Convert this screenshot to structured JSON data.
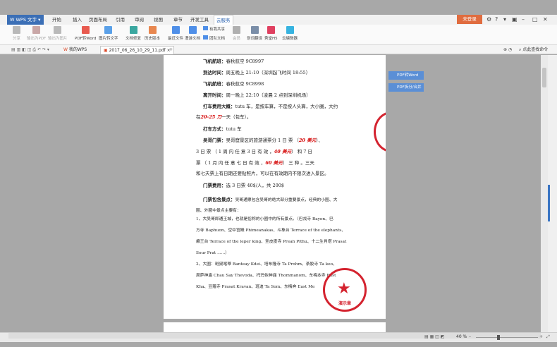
{
  "app": {
    "name": "WPS 文字"
  },
  "menu": [
    "开始",
    "插入",
    "页面布局",
    "引用",
    "审阅",
    "视图",
    "章节",
    "开发工具",
    "云服务"
  ],
  "menu_active": "云服务",
  "login_label": "未登录",
  "ribbon": [
    {
      "label": "分享",
      "color": "#b9b9b9",
      "disabled": true
    },
    {
      "label": "输出为PDF",
      "color": "#c9a7a7",
      "disabled": true
    },
    {
      "label": "输出为图片",
      "color": "#b9b9b9",
      "disabled": true
    },
    {
      "label": "PDF转Word",
      "color": "#e85a4f",
      "disabled": false
    },
    {
      "label": "图片转文字",
      "color": "#5aa0e8",
      "disabled": false
    },
    {
      "label": "文档修复",
      "color": "#3aa7a0",
      "disabled": false
    },
    {
      "label": "历史版本",
      "color": "#e8874f",
      "disabled": false
    },
    {
      "label": "最近文件",
      "color": "#4f8fe8",
      "disabled": false
    },
    {
      "label": "漫游文档",
      "color": "#4f8fe8",
      "disabled": false
    },
    {
      "label": "会员",
      "color": "#b0b0b0",
      "disabled": true
    },
    {
      "label": "划词翻译",
      "color": "#7a8ea8",
      "disabled": false
    },
    {
      "label": "秀堂H5",
      "color": "#e04060",
      "disabled": false
    },
    {
      "label": "云编辑器",
      "color": "#37b3e0",
      "disabled": false
    }
  ],
  "ribbon_small": [
    "有我共享",
    "团队文档"
  ],
  "tabs": [
    {
      "label": "我的WPS"
    },
    {
      "label": "2017_06_26_10_29_11.pdf"
    }
  ],
  "search_placeholder": "点此查找命令",
  "side_buttons": [
    "PDF转Word",
    "PDF拆分/合并"
  ],
  "doc": {
    "l1_label": "飞机航班：",
    "l1_value": "春秋航空 9C8997",
    "l2_label": "到达时间：",
    "l2_value": "周五晚上 21:10（深圳起飞时间 18:55）",
    "l3_label": "飞机航班：",
    "l3_value": "春秋航空 9C8998",
    "l4_label": "离开时间：",
    "l4_value": "周一晚上 22:10（凌晨 2 点到深圳机场）",
    "l5_label": "打车费用大概：",
    "l5_value": "tutu 车，是按车算，不是按人头算，大小圈，大约",
    "l6_pre": "在",
    "l6_red": "20-25 刀",
    "l6_post": "一天（包车）。",
    "l7_label": "打车方式：",
    "l7_value": "tutu 车",
    "l8_label": "吴哥门票：",
    "l8_value": "吴哥窟景区的旅游通票分 1 日 票 （",
    "l8_red": "20 美元",
    "l8_tail": "）、",
    "l9_a": "3 日 票 （ 1 周 内 任 意 3 日 有 效 ，",
    "l9_red": "40 美元",
    "l9_b": "） 和 7 日",
    "l10_a": "票 （ 1 月 内 任 意 七 日 有 效 ，",
    "l10_red": "60 美元",
    "l10_b": "） 三 种 。三天",
    "l11": "和七天票上有日期还要贴照片，可以在有效期内不限次进入景区。",
    "l12_label": "门票费用：",
    "l12_value": "选 3 日票 40$/人，共 200$",
    "l13_label": "门票包含景点：",
    "l13_value": "吴哥通票包含吴哥的绝大部分重要景点，经典的小圈、大",
    "l14": "圈、外圈中景点主要有：",
    "l15": "1、大吴哥即通王城，也就是俗称的小圈中的所有景点。（巴戎寺 Bayon、巴",
    "l16": "方寺 Baphuon、空中宫殿 Phimeanakas、斗象台 Terrace of the elephants、",
    "l17": "癞王台 Terrace of the leper king、圣皮度寺 Preah Pithu、十二生肖塔 Prasat",
    "l18": "Sour Prat ......）",
    "l19": "2、大圈：斑黛喀蒂 Banteay Kdei、塔布隆寺 Ta Prohm、茶胶寺 Ta keo、",
    "l20": "周萨神庙 Chau Say Thevoda、托玛侬神庙 Thommanom、东梅本寺 East",
    "l21": "Kha、豆蔻寺 Prasat Kravan、班迪 Ta Som、东梅奔 East Me"
  },
  "stamp": {
    "text": "演示章"
  },
  "status": {
    "zoom": "40 %"
  },
  "colors": {
    "accent": "#3b6fb6",
    "stamp": "#d4232f",
    "login": "#e06c3f"
  }
}
